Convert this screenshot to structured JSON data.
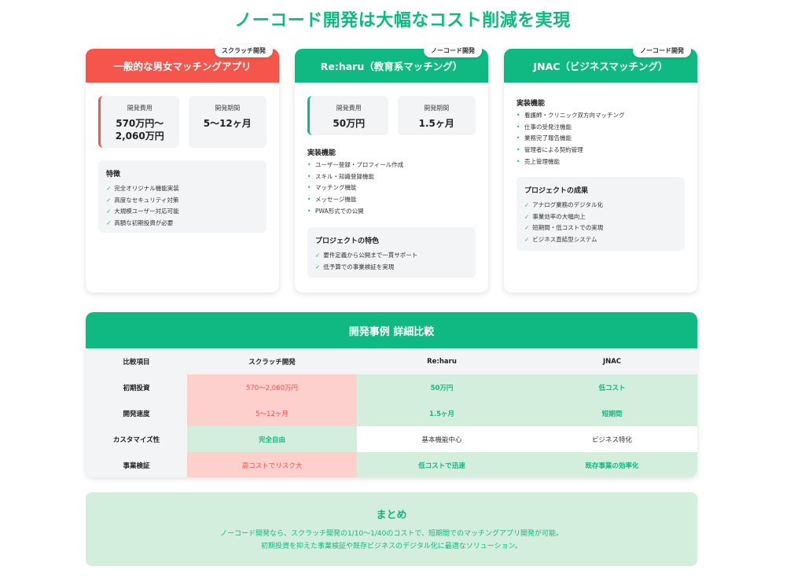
{
  "title": "ノーコード開発は大幅なコスト削減を実現",
  "cards": {
    "scratch": {
      "tag": "スクラッチ開発",
      "title": "一般的な男女マッチングアプリ",
      "cost_label": "開発費用",
      "cost_line1": "570万円〜",
      "cost_line2": "2,060万円",
      "period_label": "開発期間",
      "period_value": "5〜12ヶ月",
      "features_title": "特徴",
      "features": [
        "完全オリジナル機能実装",
        "高度なセキュリティ対策",
        "大規模ユーザー対応可能",
        "高額な初期投資が必要"
      ]
    },
    "reharu": {
      "tag": "ノーコード開発",
      "title": "Re:haru（教育系マッチング）",
      "cost_label": "開発費用",
      "cost_value": "50万円",
      "period_label": "開発期間",
      "period_value": "1.5ヶ月",
      "features_title": "実装機能",
      "features": [
        "ユーザー登録・プロフィール作成",
        "スキル・知識登録機能",
        "マッチング機能",
        "メッセージ機能",
        "PWA形式での公開"
      ],
      "traits_title": "プロジェクトの特色",
      "traits": [
        "要件定義から公開まで一貫サポート",
        "低予算での事業検証を実現"
      ]
    },
    "jnac": {
      "tag": "ノーコード開発",
      "title": "JNAC（ビジネスマッチング）",
      "features_title": "実装機能",
      "features": [
        "看護師・クリニック双方向マッチング",
        "仕事の受発注機能",
        "業務完了報告機能",
        "管理者による契約管理",
        "売上管理機能"
      ],
      "results_title": "プロジェクトの成果",
      "results": [
        "アナログ業務のデジタル化",
        "事業効率の大幅向上",
        "短期間・低コストでの実現",
        "ビジネス直結型システム"
      ]
    }
  },
  "comparison": {
    "title": "開発事例 詳細比較",
    "headers": [
      "比較項目",
      "スクラッチ開発",
      "Re:haru",
      "JNAC"
    ],
    "rows": [
      [
        "初期投資",
        "570〜2,060万円",
        "50万円",
        "低コスト"
      ],
      [
        "開発速度",
        "5〜12ヶ月",
        "1.5ヶ月",
        "短期間"
      ],
      [
        "カスタマイズ性",
        "完全自由",
        "基本機能中心",
        "ビジネス特化"
      ],
      [
        "事業検証",
        "高コストでリスク大",
        "低コストで迅速",
        "既存事業の効率化"
      ]
    ]
  },
  "summary": {
    "title": "まとめ",
    "line1": "ノーコード開発なら、スクラッチ開発の1/10〜1/40のコストで、短期間でのマッチングアプリ開発が可能。",
    "line2": "初期投資を抑えた事業検証や既存ビジネスのデジタル化に最適なソリューション。"
  },
  "colors": {
    "accent_green": "#10b981",
    "accent_red": "#f5554a",
    "light_green": "#d4eedd",
    "light_red": "#fdcfcd"
  },
  "icons": {
    "check": "check-icon",
    "bullet": "bullet-icon"
  }
}
